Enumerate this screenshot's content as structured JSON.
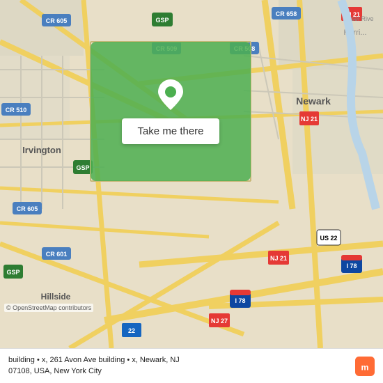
{
  "map": {
    "background_color": "#e8dfc8",
    "overlay_color": "#4caf50"
  },
  "button": {
    "label": "Take me there"
  },
  "bottom_bar": {
    "address_line1": "building • x, 261 Avon Ave building • x, Newark, NJ",
    "address_line2": "07108, USA, New York City",
    "osm_credit": "© OpenStreetMap contributors"
  },
  "logo": {
    "text": "moovit"
  }
}
